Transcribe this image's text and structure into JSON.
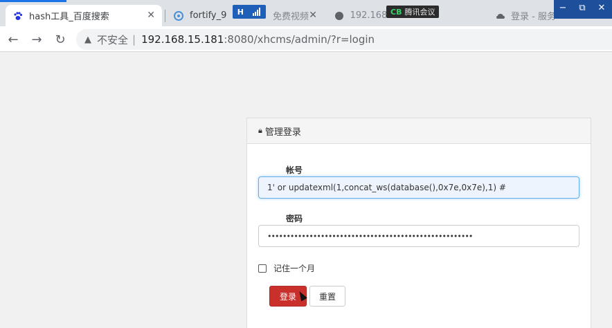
{
  "browser": {
    "tabs": [
      {
        "title": "hash工具_百度搜索",
        "icon": "baidu-paw-icon"
      },
      {
        "title": "fortify_9",
        "icon": "cloud-icon"
      },
      {
        "title": "192.168",
        "icon": "globe-icon"
      },
      {
        "title": "登录 - 服务中",
        "icon": "cloud-icon"
      }
    ],
    "hidden_tab_fragment": "免费视频",
    "overlay": {
      "meeting_badge_prefix": "CB",
      "meeting_badge_label": "腾讯会议"
    },
    "window_controls": [
      "−",
      "⧉",
      "✕"
    ],
    "address": {
      "security_label": "不安全",
      "separator": "|",
      "host": "192.168.15.181",
      "path": ":8080/xhcms/admin/?r=login"
    }
  },
  "login": {
    "heading": "管理登录",
    "account_label": "帐号",
    "account_value": "1' or updatexml(1,concat_ws(database(),0x7e,0x7e),1) #",
    "password_label": "密码",
    "password_value": "••••••••••••••••••••••••••••••••••••••••••••••••••••••",
    "remember_label": "记住一个月",
    "login_button": "登录",
    "reset_button": "重置"
  },
  "colors": {
    "login_button": "#c9302c",
    "focus_border": "#66afe9",
    "tab_strip": "#dee1e6"
  }
}
